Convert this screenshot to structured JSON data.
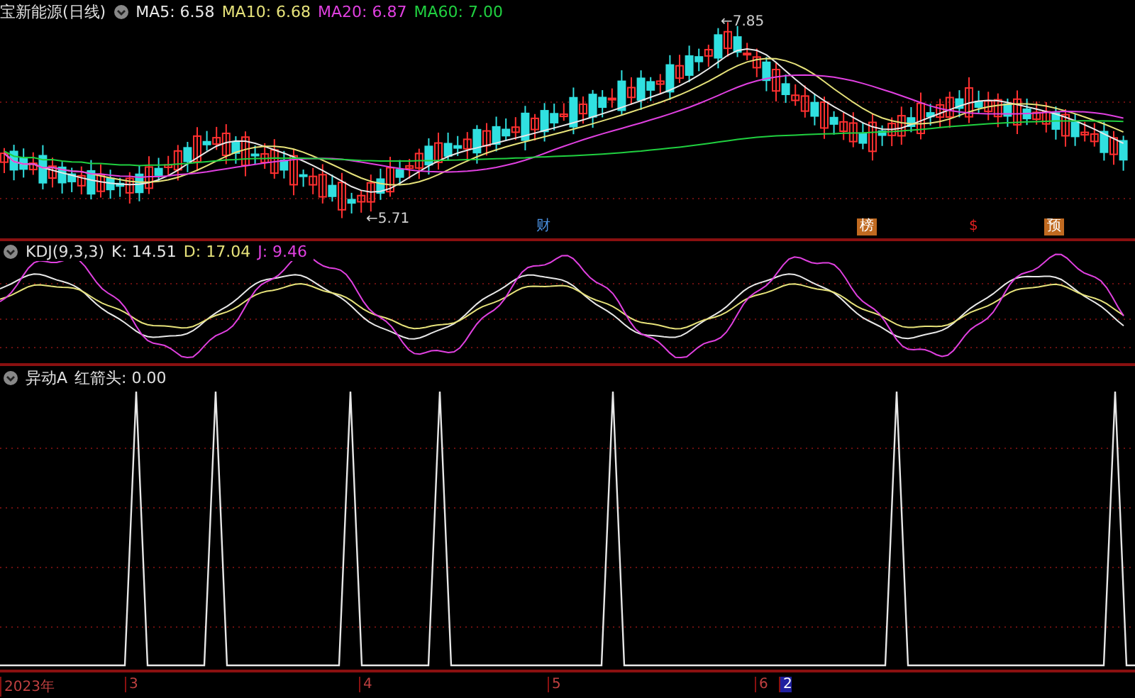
{
  "price_pane": {
    "title": "宝新能源(日线)",
    "indicators": [
      {
        "label": "MA5: 6.58",
        "color": "#e8e8e8"
      },
      {
        "label": "MA10: 6.68",
        "color": "#e6e27a"
      },
      {
        "label": "MA20: 6.87",
        "color": "#e040e0"
      },
      {
        "label": "MA60: 7.00",
        "color": "#20d040"
      }
    ],
    "high_label": "←7.85",
    "low_label": "←5.71",
    "events": [
      {
        "label": "财",
        "color": "#4a90e0"
      },
      {
        "label": "榜",
        "color": "#c06a20"
      },
      {
        "label": "$",
        "color": "#e02020"
      },
      {
        "label": "预",
        "color": "#c06a20"
      }
    ]
  },
  "kdj_pane": {
    "title": "KDJ(9,3,3)",
    "values": [
      {
        "label": "K: 14.51",
        "color": "#e8e8e8"
      },
      {
        "label": "D: 17.04",
        "color": "#e6e27a"
      },
      {
        "label": "J: 9.46",
        "color": "#e040e0"
      }
    ]
  },
  "signal_pane": {
    "title": "异动A",
    "value": "红箭头: 0.00"
  },
  "time_axis": [
    {
      "label": "2023年",
      "selected": false
    },
    {
      "label": "3",
      "selected": false
    },
    {
      "label": "4",
      "selected": false
    },
    {
      "label": "5",
      "selected": false
    },
    {
      "label": "6",
      "selected": false
    },
    {
      "label": "2",
      "selected": true
    }
  ]
}
